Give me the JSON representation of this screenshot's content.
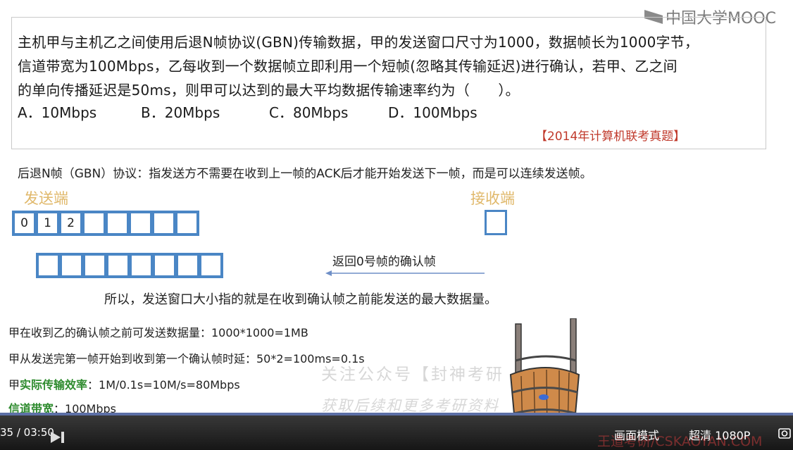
{
  "logo": {
    "text": "中国大学MOOC"
  },
  "question": {
    "line1": "主机甲与主机乙之间使用后退N帧协议(GBN)传输数据，甲的发送窗口尺寸为1000，数据帧长为1000字节，",
    "line2": "信道带宽为100Mbps，乙每收到一个数据帧立即利用一个短帧(忽略其传输延迟)进行确认，若甲、乙之间",
    "line3": "的单向传播延迟是50ms，则甲可以达到的最大平均数据传输速率约为（　　）。",
    "options": [
      {
        "label": "A．10Mbps"
      },
      {
        "label": "B．20Mbps"
      },
      {
        "label": "C．80Mbps"
      },
      {
        "label": "D．100Mbps"
      }
    ],
    "source": "【2014年计算机联考真题】"
  },
  "explanation": "后退N帧（GBN）协议：指发送方不需要在收到上一帧的ACK后才能开始发送下一帧，而是可以连续发送帧。",
  "diagram": {
    "sender_label": "发送端",
    "receiver_label": "接收端",
    "sender_cells": [
      "0",
      "1",
      "2",
      "",
      "",
      "",
      "",
      ""
    ],
    "bottom_cells": [
      "",
      "",
      "",
      "",
      "",
      "",
      "",
      ""
    ],
    "ack_label": "返回0号帧的确认帧",
    "conclusion": "所以，发送窗口大小指的就是在收到确认帧之前能发送的最大数据量。"
  },
  "calc": {
    "line1": "甲在收到乙的确认帧之前可发送数据量：1000*1000=1MB",
    "line2": "甲从发送完第一帧开始到收到第一个确认帧时延：50*2=100ms=0.1s",
    "line3_prefix": "甲",
    "line3_highlight": "实际传输效率",
    "line3_rest": "：1M/0.1s=10M/s=80Mbps",
    "line4_highlight": "信道带宽",
    "line4_rest": "：100Mbps"
  },
  "watermark": {
    "line1": "关注公众号【封神考研",
    "line2": "获取后续和更多考研资料",
    "site": "王道考研/CSKAOYAN.COM"
  },
  "player": {
    "time": "35 / 03:50",
    "mode": "画面模式",
    "quality": "超清 1080P",
    "progress": 0.02,
    "colors": {
      "bar": "#1e1e1e",
      "progress": "#5c6fa6"
    }
  }
}
